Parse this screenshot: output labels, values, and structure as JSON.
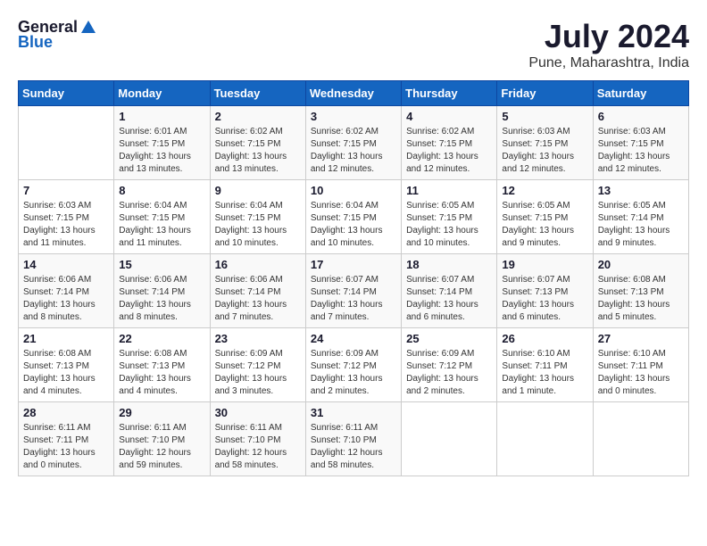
{
  "logo": {
    "general": "General",
    "blue": "Blue"
  },
  "title": "July 2024",
  "subtitle": "Pune, Maharashtra, India",
  "days_of_week": [
    "Sunday",
    "Monday",
    "Tuesday",
    "Wednesday",
    "Thursday",
    "Friday",
    "Saturday"
  ],
  "weeks": [
    [
      {
        "day": "",
        "sunrise": "",
        "sunset": "",
        "daylight": ""
      },
      {
        "day": "1",
        "sunrise": "Sunrise: 6:01 AM",
        "sunset": "Sunset: 7:15 PM",
        "daylight": "Daylight: 13 hours and 13 minutes."
      },
      {
        "day": "2",
        "sunrise": "Sunrise: 6:02 AM",
        "sunset": "Sunset: 7:15 PM",
        "daylight": "Daylight: 13 hours and 13 minutes."
      },
      {
        "day": "3",
        "sunrise": "Sunrise: 6:02 AM",
        "sunset": "Sunset: 7:15 PM",
        "daylight": "Daylight: 13 hours and 12 minutes."
      },
      {
        "day": "4",
        "sunrise": "Sunrise: 6:02 AM",
        "sunset": "Sunset: 7:15 PM",
        "daylight": "Daylight: 13 hours and 12 minutes."
      },
      {
        "day": "5",
        "sunrise": "Sunrise: 6:03 AM",
        "sunset": "Sunset: 7:15 PM",
        "daylight": "Daylight: 13 hours and 12 minutes."
      },
      {
        "day": "6",
        "sunrise": "Sunrise: 6:03 AM",
        "sunset": "Sunset: 7:15 PM",
        "daylight": "Daylight: 13 hours and 12 minutes."
      }
    ],
    [
      {
        "day": "7",
        "sunrise": "Sunrise: 6:03 AM",
        "sunset": "Sunset: 7:15 PM",
        "daylight": "Daylight: 13 hours and 11 minutes."
      },
      {
        "day": "8",
        "sunrise": "Sunrise: 6:04 AM",
        "sunset": "Sunset: 7:15 PM",
        "daylight": "Daylight: 13 hours and 11 minutes."
      },
      {
        "day": "9",
        "sunrise": "Sunrise: 6:04 AM",
        "sunset": "Sunset: 7:15 PM",
        "daylight": "Daylight: 13 hours and 10 minutes."
      },
      {
        "day": "10",
        "sunrise": "Sunrise: 6:04 AM",
        "sunset": "Sunset: 7:15 PM",
        "daylight": "Daylight: 13 hours and 10 minutes."
      },
      {
        "day": "11",
        "sunrise": "Sunrise: 6:05 AM",
        "sunset": "Sunset: 7:15 PM",
        "daylight": "Daylight: 13 hours and 10 minutes."
      },
      {
        "day": "12",
        "sunrise": "Sunrise: 6:05 AM",
        "sunset": "Sunset: 7:15 PM",
        "daylight": "Daylight: 13 hours and 9 minutes."
      },
      {
        "day": "13",
        "sunrise": "Sunrise: 6:05 AM",
        "sunset": "Sunset: 7:14 PM",
        "daylight": "Daylight: 13 hours and 9 minutes."
      }
    ],
    [
      {
        "day": "14",
        "sunrise": "Sunrise: 6:06 AM",
        "sunset": "Sunset: 7:14 PM",
        "daylight": "Daylight: 13 hours and 8 minutes."
      },
      {
        "day": "15",
        "sunrise": "Sunrise: 6:06 AM",
        "sunset": "Sunset: 7:14 PM",
        "daylight": "Daylight: 13 hours and 8 minutes."
      },
      {
        "day": "16",
        "sunrise": "Sunrise: 6:06 AM",
        "sunset": "Sunset: 7:14 PM",
        "daylight": "Daylight: 13 hours and 7 minutes."
      },
      {
        "day": "17",
        "sunrise": "Sunrise: 6:07 AM",
        "sunset": "Sunset: 7:14 PM",
        "daylight": "Daylight: 13 hours and 7 minutes."
      },
      {
        "day": "18",
        "sunrise": "Sunrise: 6:07 AM",
        "sunset": "Sunset: 7:14 PM",
        "daylight": "Daylight: 13 hours and 6 minutes."
      },
      {
        "day": "19",
        "sunrise": "Sunrise: 6:07 AM",
        "sunset": "Sunset: 7:13 PM",
        "daylight": "Daylight: 13 hours and 6 minutes."
      },
      {
        "day": "20",
        "sunrise": "Sunrise: 6:08 AM",
        "sunset": "Sunset: 7:13 PM",
        "daylight": "Daylight: 13 hours and 5 minutes."
      }
    ],
    [
      {
        "day": "21",
        "sunrise": "Sunrise: 6:08 AM",
        "sunset": "Sunset: 7:13 PM",
        "daylight": "Daylight: 13 hours and 4 minutes."
      },
      {
        "day": "22",
        "sunrise": "Sunrise: 6:08 AM",
        "sunset": "Sunset: 7:13 PM",
        "daylight": "Daylight: 13 hours and 4 minutes."
      },
      {
        "day": "23",
        "sunrise": "Sunrise: 6:09 AM",
        "sunset": "Sunset: 7:12 PM",
        "daylight": "Daylight: 13 hours and 3 minutes."
      },
      {
        "day": "24",
        "sunrise": "Sunrise: 6:09 AM",
        "sunset": "Sunset: 7:12 PM",
        "daylight": "Daylight: 13 hours and 2 minutes."
      },
      {
        "day": "25",
        "sunrise": "Sunrise: 6:09 AM",
        "sunset": "Sunset: 7:12 PM",
        "daylight": "Daylight: 13 hours and 2 minutes."
      },
      {
        "day": "26",
        "sunrise": "Sunrise: 6:10 AM",
        "sunset": "Sunset: 7:11 PM",
        "daylight": "Daylight: 13 hours and 1 minute."
      },
      {
        "day": "27",
        "sunrise": "Sunrise: 6:10 AM",
        "sunset": "Sunset: 7:11 PM",
        "daylight": "Daylight: 13 hours and 0 minutes."
      }
    ],
    [
      {
        "day": "28",
        "sunrise": "Sunrise: 6:11 AM",
        "sunset": "Sunset: 7:11 PM",
        "daylight": "Daylight: 13 hours and 0 minutes."
      },
      {
        "day": "29",
        "sunrise": "Sunrise: 6:11 AM",
        "sunset": "Sunset: 7:10 PM",
        "daylight": "Daylight: 12 hours and 59 minutes."
      },
      {
        "day": "30",
        "sunrise": "Sunrise: 6:11 AM",
        "sunset": "Sunset: 7:10 PM",
        "daylight": "Daylight: 12 hours and 58 minutes."
      },
      {
        "day": "31",
        "sunrise": "Sunrise: 6:11 AM",
        "sunset": "Sunset: 7:10 PM",
        "daylight": "Daylight: 12 hours and 58 minutes."
      },
      {
        "day": "",
        "sunrise": "",
        "sunset": "",
        "daylight": ""
      },
      {
        "day": "",
        "sunrise": "",
        "sunset": "",
        "daylight": ""
      },
      {
        "day": "",
        "sunrise": "",
        "sunset": "",
        "daylight": ""
      }
    ]
  ]
}
